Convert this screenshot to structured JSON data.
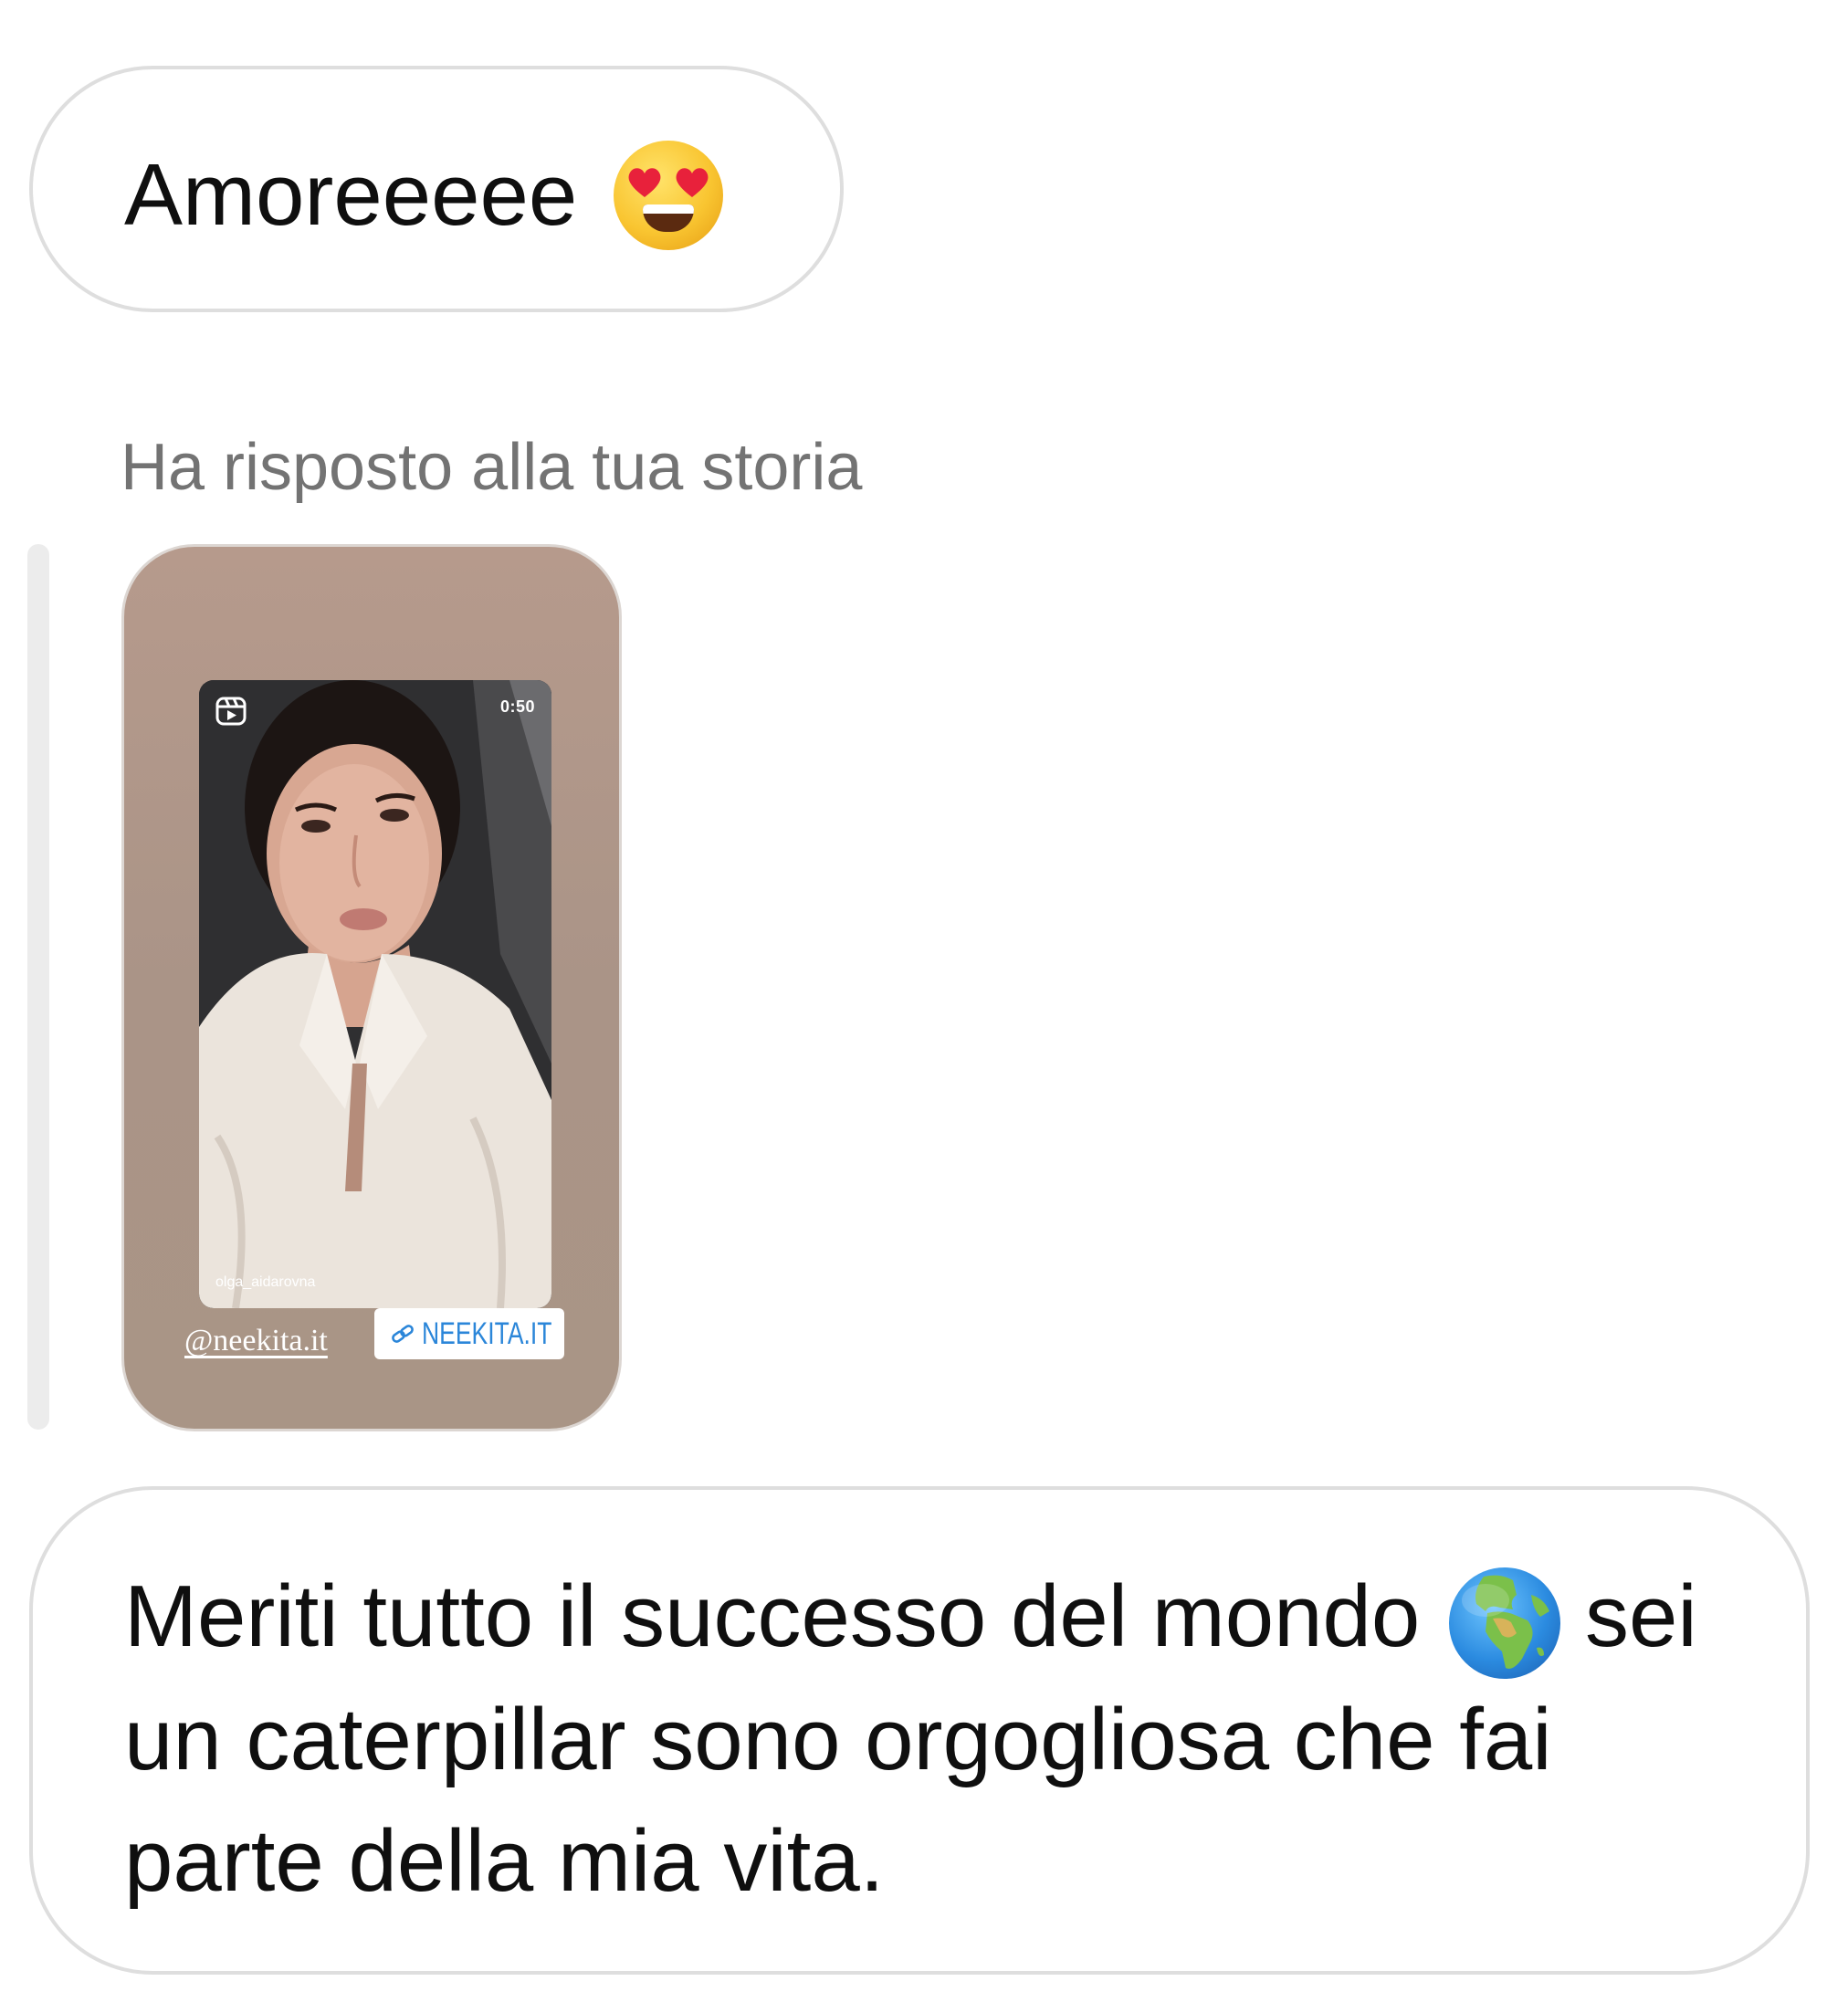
{
  "messages": [
    {
      "text": "Amoreeeee",
      "emoji": "smiling-face-with-heart-eyes-icon"
    },
    {
      "text": "Meriti tutto il successo del mondo",
      "emoji": "globe-europe-africa-icon",
      "continuation": "sei un caterpillar sono orgogliosa che fai parte della mia vita."
    }
  ],
  "story_reply": {
    "label": "Ha risposto alla tua storia",
    "story": {
      "reel_duration": "0:50",
      "reel_username": "olga_aidarovna",
      "mention": "@neekita.it",
      "link_label": "NEEKITA.IT",
      "background_color": "#ac9587",
      "link_color": "#2b86d9"
    }
  },
  "colors": {
    "bubble_border": "#dedede",
    "label_gray": "#737373",
    "text": "#0f0f0f"
  }
}
